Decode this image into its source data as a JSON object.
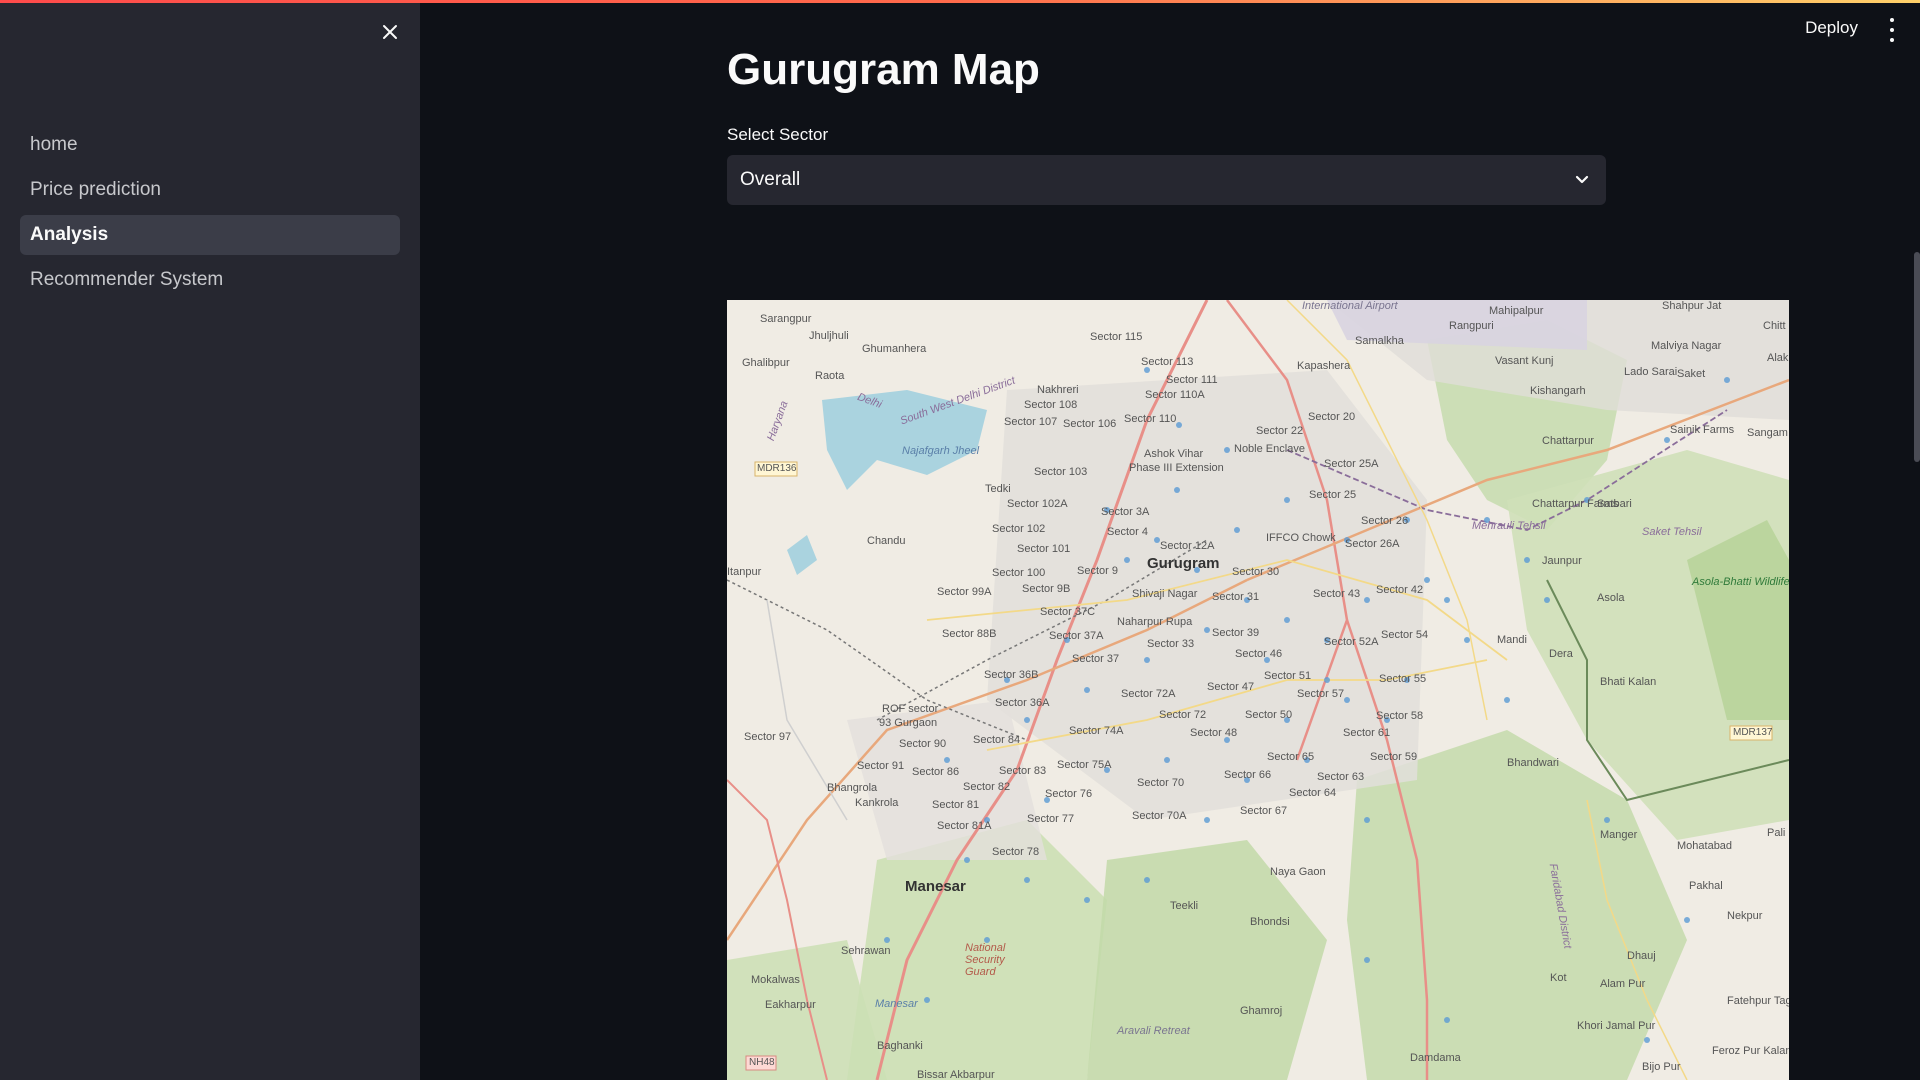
{
  "sidebar": {
    "close_icon": "close-icon",
    "items": [
      {
        "label": "home",
        "active": false
      },
      {
        "label": "Price prediction",
        "active": false
      },
      {
        "label": "Analysis",
        "active": true
      },
      {
        "label": "Recommender System",
        "active": false
      }
    ]
  },
  "header": {
    "deploy_label": "Deploy",
    "menu_icon": "kebab-menu-icon"
  },
  "main": {
    "title": "Gurugram Map",
    "select_label": "Select Sector",
    "select_value": "Overall"
  },
  "map": {
    "labels": {
      "gurugram": "Gurugram",
      "manesar": "Manesar",
      "sector_115": "Sector 115",
      "sector_113": "Sector 113",
      "sector_111": "Sector 111",
      "sector_110a": "Sector 110A",
      "sector_110": "Sector 110",
      "sector_108": "Sector 108",
      "sector_107": "Sector 107",
      "sector_106": "Sector 106",
      "sector_103": "Sector 103",
      "sector_102a": "Sector 102A",
      "sector_102": "Sector 102",
      "sector_101": "Sector 101",
      "sector_100": "Sector 100",
      "sector_99a": "Sector 99A",
      "sector_9b": "Sector 9B",
      "sector_9": "Sector 9",
      "sector_37c": "Sector 37C",
      "sector_37a": "Sector 37A",
      "sector_37": "Sector 37",
      "sector_36b": "Sector 36B",
      "sector_36a": "Sector 36A",
      "sector_88b": "Sector 88B",
      "sector_97": "Sector 97",
      "sector_90": "Sector 90",
      "sector_91": "Sector 91",
      "sector_86": "Sector 86",
      "sector_84": "Sector 84",
      "sector_83": "Sector 83",
      "sector_82": "Sector 82",
      "sector_81": "Sector 81",
      "sector_81a": "Sector 81A",
      "sector_78": "Sector 78",
      "sector_77": "Sector 77",
      "sector_76": "Sector 76",
      "sector_75a": "Sector 75A",
      "sector_74a": "Sector 74A",
      "sector_72a": "Sector 72A",
      "sector_72": "Sector 72",
      "sector_70": "Sector 70",
      "sector_70a": "Sector 70A",
      "sector_48": "Sector 48",
      "sector_47": "Sector 47",
      "sector_46": "Sector 46",
      "sector_39": "Sector 39",
      "sector_33": "Sector 33",
      "sector_31": "Sector 31",
      "sector_30": "Sector 30",
      "sector_50": "Sector 50",
      "sector_51": "Sector 51",
      "sector_57": "Sector 57",
      "sector_58": "Sector 58",
      "sector_61": "Sector 61",
      "sector_59": "Sector 59",
      "sector_65": "Sector 65",
      "sector_63": "Sector 63",
      "sector_64": "Sector 64",
      "sector_66": "Sector 66",
      "sector_67": "Sector 67",
      "sector_55": "Sector 55",
      "sector_54": "Sector 54",
      "sector_52a": "Sector 52A",
      "sector_43": "Sector 43",
      "sector_42": "Sector 42",
      "sector_26a": "Sector 26A",
      "sector_26": "Sector 26",
      "sector_25": "Sector 25",
      "sector_25a": "Sector 25A",
      "sector_22": "Sector 22",
      "sector_20": "Sector 20",
      "sector_12a": "Sector 12A",
      "sector_4": "Sector 4",
      "sector_3a": "Sector 3A",
      "shivaji_nagar": "Shivaji Nagar",
      "naharpur_rupa": "Naharpur Rupa",
      "ashok_vihar": "Ashok Vihar",
      "ashok_vihar_ext": "Phase III Extension",
      "noble_enclave": "Noble Enclave",
      "iffco_chowk": "IFFCO Chowk",
      "samalkha": "Samalkha",
      "kapashera": "Kapashera",
      "rangpuri": "Rangpuri",
      "mahipalpur": "Mahipalpur",
      "vasant_kunj": "Vasant Kunj",
      "malviya_nagar": "Malviya Nagar",
      "lado_sarai": "Lado Sarai",
      "saket": "Saket",
      "kishangarh": "Kishangarh",
      "chattarpur": "Chattarpur",
      "chattarpur_farms": "Chattarpur Farms",
      "satbari": "Satbari",
      "sainik_farms": "Sainik Farms",
      "jaunpur": "Jaunpur",
      "asola": "Asola",
      "asola_bhatti": "Asola-Bhatti Wildlife Sanctuary",
      "mandi": "Mandi",
      "dera": "Dera",
      "bhati_kalan": "Bhati Kalan",
      "bhandwari": "Bhandwari",
      "manger": "Manger",
      "mohatabad": "Mohatabad",
      "pakhal": "Pakhal",
      "nekpur": "Nekpur",
      "dhauj": "Dhauj",
      "alam_pur": "Alam Pur",
      "kot": "Kot",
      "khori_jamal": "Khori Jamal Pur",
      "fatehpur_taga": "Fatehpur Taga",
      "feroz_pur_kalan": "Feroz Pur Kalan",
      "bijo_pur": "Bijo Pur",
      "damdama": "Damdama",
      "naya_gaon": "Naya Gaon",
      "teekli": "Teekli",
      "bhondsi": "Bhondsi",
      "ghamroj": "Ghamroj",
      "sarangpur": "Sarangpur",
      "jhuljhuli": "Jhuljhuli",
      "ghumanhera": "Ghumanhera",
      "ghalibpur": "Ghalibpur",
      "raota": "Raota",
      "nakhreri": "Nakhreri",
      "tedki": "Tedki",
      "chandu": "Chandu",
      "itanpur": "Itanpur",
      "mdr136": "MDR136",
      "mdr137": "MDR137",
      "rof_sector": "ROF sector",
      "sector_93": "93 Gurgaon",
      "bhangrola": "Bhangrola",
      "kankrola": "Kankrola",
      "sehrawan": "Sehrawan",
      "mokalwas": "Mokalwas",
      "eakharpur": "Eakharpur",
      "manesar_lake": "Manesar",
      "nsg": "National Security Guard",
      "baghanki": "Baghanki",
      "bissar_akbarpur": "Bissar Akbarpur",
      "nh48": "NH48",
      "najafgarh_jheel": "Najafgarh Jheel",
      "delhi": "Delhi",
      "haryana": "Haryana",
      "south_west_delhi": "South West Delhi District",
      "intl_airport": "International Airport",
      "mehrauli": "Mehrauli Tehsil",
      "saket_tehsil": "Saket Tehsil",
      "faridabad_district": "Faridabad District",
      "aravali_retreat": "Aravali Retreat",
      "pali": "Pali",
      "sangam_vihar": "Sangam Vihar",
      "chittaranjan": "Chitt",
      "alak": "Alak",
      "shahpur_jat": "Shahpur Jat"
    }
  }
}
